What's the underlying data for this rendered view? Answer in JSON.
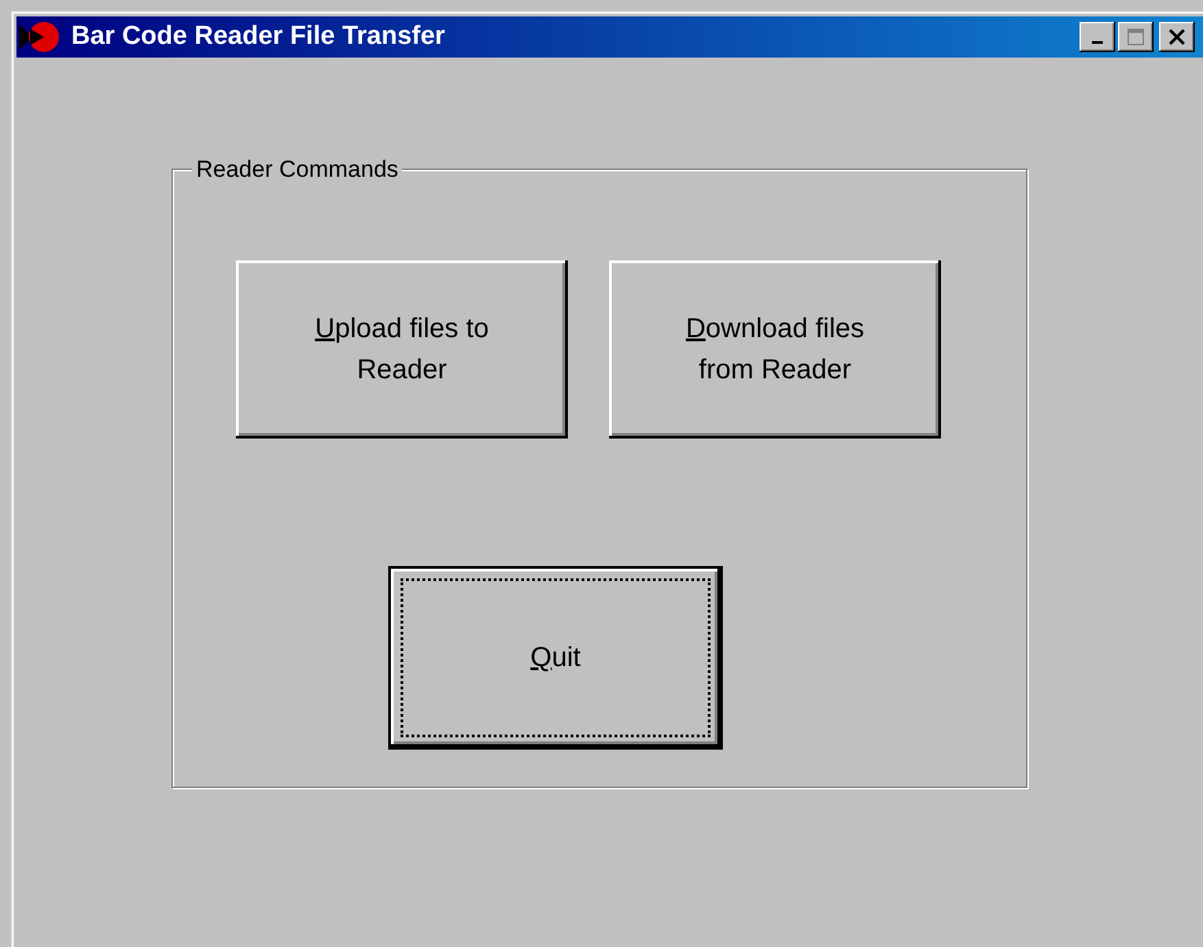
{
  "window": {
    "title": "Bar Code Reader File Transfer"
  },
  "group": {
    "label": "Reader Commands"
  },
  "buttons": [
    {
      "label_lines": [
        "Upload files to",
        "Reader"
      ],
      "access_key_underlined": true,
      "focused": false
    },
    {
      "label_lines": [
        "Download files",
        "from Reader"
      ],
      "access_key_underlined": true,
      "focused": false
    },
    {
      "label_lines": [
        "Quit"
      ],
      "access_key_underlined": true,
      "focused": true
    }
  ]
}
